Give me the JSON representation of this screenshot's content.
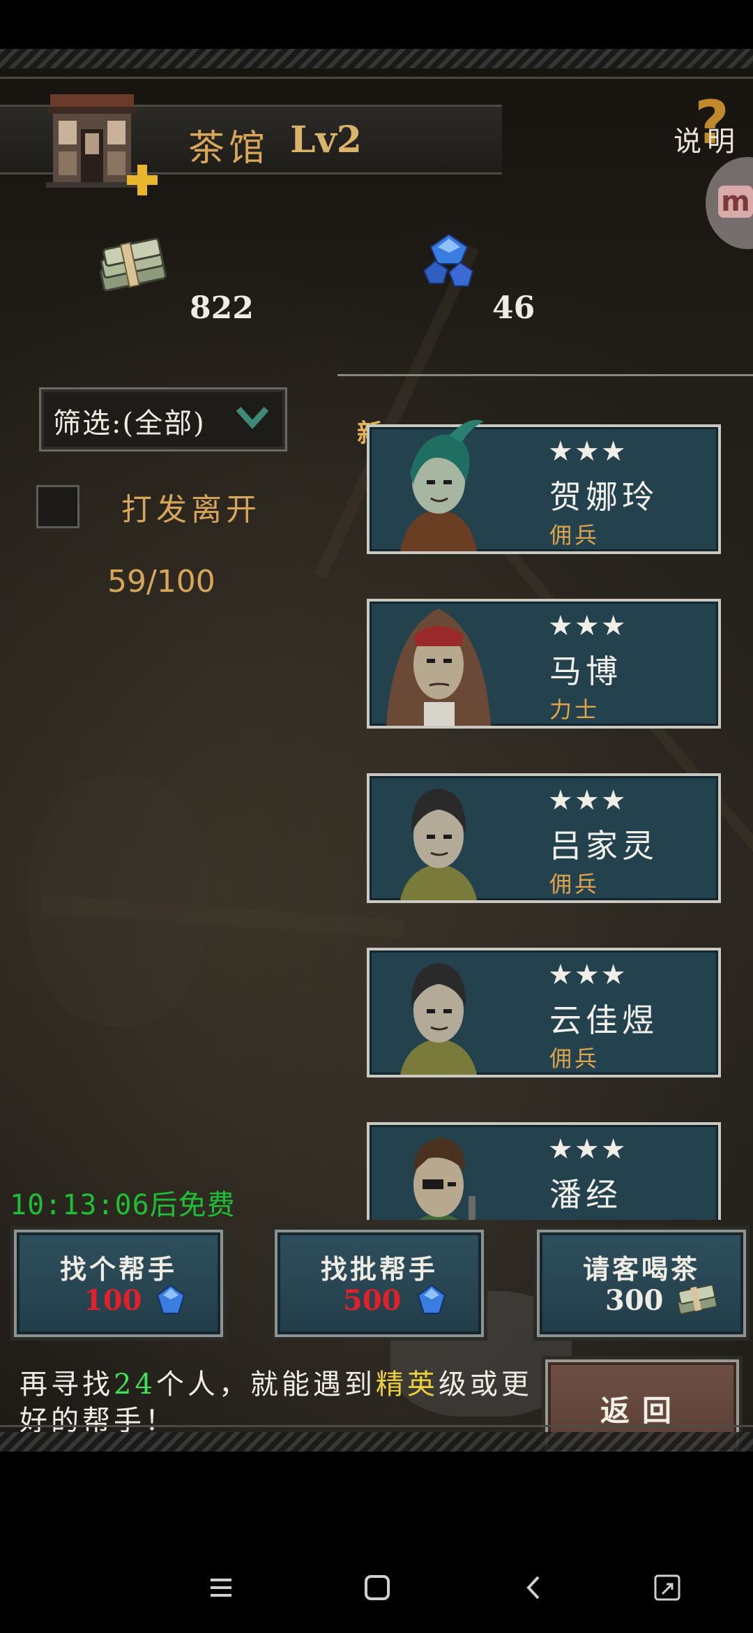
{
  "header": {
    "title": "茶馆",
    "level": "Lv2",
    "help_label": "说明",
    "help_glyph": "?",
    "overlay_letter": "m"
  },
  "resources": {
    "money": "822",
    "gems": "46"
  },
  "filter": {
    "label": "筛选:(全部)"
  },
  "dismiss": {
    "label": "打发离开",
    "checked": false
  },
  "capacity": "59/100",
  "new_badge": "新",
  "heroes": [
    {
      "stars": "★★★",
      "name": "贺娜玲",
      "class": "佣兵"
    },
    {
      "stars": "★★★",
      "name": "马博",
      "class": "力士"
    },
    {
      "stars": "★★★",
      "name": "吕家灵",
      "class": "佣兵"
    },
    {
      "stars": "★★★",
      "name": "云佳煜",
      "class": "佣兵"
    },
    {
      "stars": "★★★",
      "name": "潘经",
      "class": ""
    }
  ],
  "free_timer": "10:13:06后免费",
  "actions": [
    {
      "title": "找个帮手",
      "cost": "100",
      "cost_color": "#e0202a"
    },
    {
      "title": "找批帮手",
      "cost": "500",
      "cost_color": "#e0202a"
    },
    {
      "title": "请客喝茶",
      "cost": "300",
      "cost_color": "#efece4"
    }
  ],
  "hint": {
    "before": "再寻找",
    "count": "24",
    "middle": "个人，就能遇到",
    "grade": "精英",
    "after": "级或更好的帮手！"
  },
  "back_label": "返回",
  "colors": {
    "accent_gold": "#d8a659",
    "card_bg": "#24414e",
    "timer_green": "#1fbf35"
  },
  "icons": {
    "money": "cash-stack-icon",
    "gem": "blue-gem-icon",
    "chevron": "chevron-down-icon",
    "nav": [
      "menu-icon",
      "home-square-icon",
      "back-arrow-icon",
      "screen-rotate-icon"
    ]
  }
}
